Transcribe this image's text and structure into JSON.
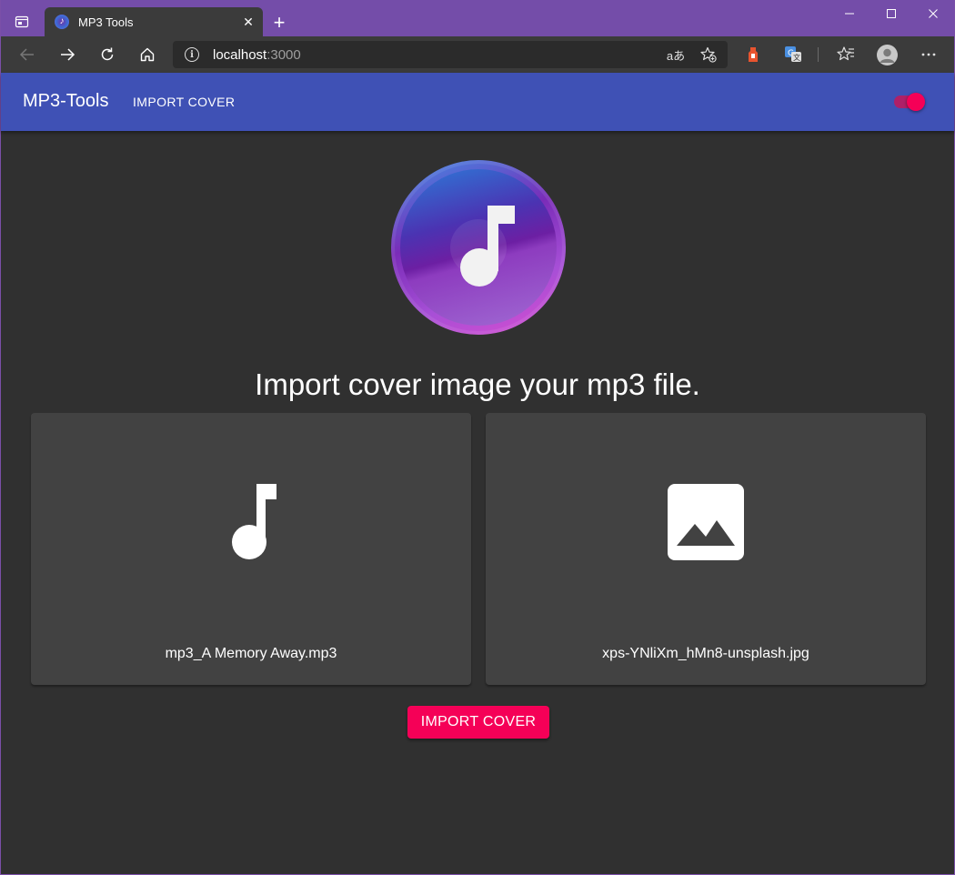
{
  "browser": {
    "tab_title": "MP3 Tools",
    "tab_close": "✕",
    "new_tab": "+",
    "url_host": "localhost",
    "url_port": ":3000",
    "read_aloud_glyph": "aあ"
  },
  "appbar": {
    "brand": "MP3-Tools",
    "nav_link": "IMPORT COVER",
    "theme_toggle_on": true
  },
  "main": {
    "headline": "Import cover image your mp3 file.",
    "audio_card": {
      "file_name": "mp3_A Memory Away.mp3",
      "icon": "music-note-icon"
    },
    "image_card": {
      "file_name": "xps-YNliXm_hMn8-unsplash.jpg",
      "icon": "image-icon"
    },
    "import_button": "IMPORT COVER"
  },
  "colors": {
    "titlebar": "#744da9",
    "toolbar": "#3b3b3b",
    "appbar": "#3f51b5",
    "background": "#303030",
    "card": "#424242",
    "accent": "#f50057"
  }
}
